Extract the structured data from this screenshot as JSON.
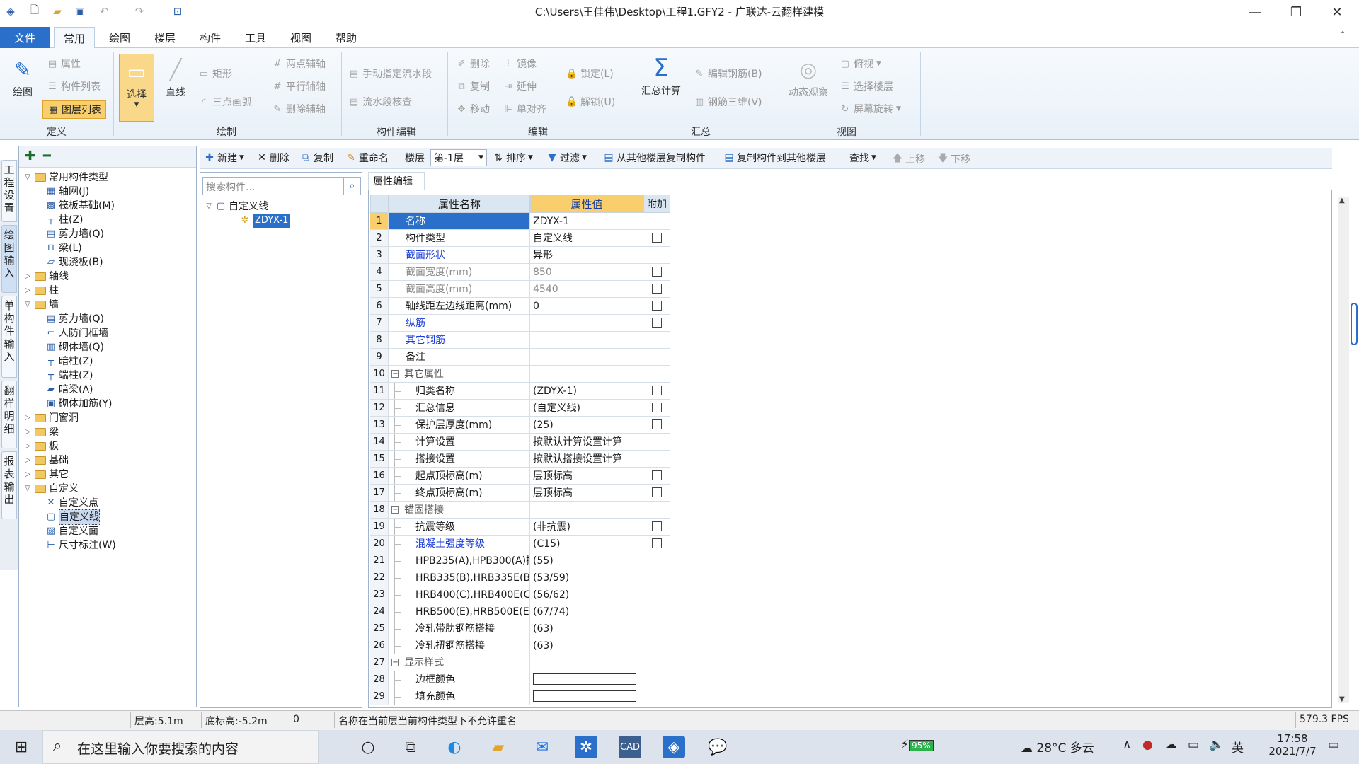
{
  "window": {
    "title": "C:\\Users\\王佳伟\\Desktop\\工程1.GFY2 - 广联达-云翻样建模"
  },
  "menu": {
    "file": "文件",
    "tabs": [
      "常用",
      "绘图",
      "楼层",
      "构件",
      "工具",
      "视图",
      "帮助"
    ]
  },
  "ribbon": {
    "define": {
      "label": "定义",
      "draw_big": "绘图",
      "props": "属性",
      "comp_list": "构件列表",
      "layer_list": "图层列表"
    },
    "draw": {
      "label": "绘制",
      "select": "选择",
      "line": "直线",
      "rect": "矩形",
      "arc3": "三点画弧",
      "two_pt_axis": "两点辅轴",
      "parallel_axis": "平行辅轴",
      "delete_axis": "删除辅轴"
    },
    "comp_edit": {
      "label": "构件编辑",
      "manual_flow": "手动指定流水段",
      "flow_check": "流水段核查"
    },
    "edit": {
      "label": "编辑",
      "delete": "删除",
      "copy": "复制",
      "move": "移动",
      "mirror": "镜像",
      "extend": "延伸",
      "align": "单对齐",
      "lock": "锁定(L)",
      "unlock": "解锁(U)"
    },
    "summary": {
      "label": "汇总",
      "calc": "汇总计算",
      "edit_rebar": "编辑钢筋(B)",
      "rebar3d": "钢筋三维(V)"
    },
    "view": {
      "label": "视图",
      "dynamic": "动态观察",
      "top": "俯视",
      "select_floor": "选择楼层",
      "rotate": "屏幕旋转"
    }
  },
  "toolbar": {
    "new": "新建",
    "delete": "删除",
    "copy": "复制",
    "rename": "重命名",
    "floor_label": "楼层",
    "floor_value": "第-1层",
    "sort": "排序",
    "filter": "过滤",
    "copy_from": "从其他楼层复制构件",
    "copy_to": "复制构件到其他楼层",
    "find": "查找",
    "up": "上移",
    "down": "下移"
  },
  "side_tabs": [
    "工程设置",
    "绘图输入",
    "单构件输入",
    "翻样明细",
    "报表输出"
  ],
  "tree": [
    {
      "label": "常用构件类型",
      "level": 0,
      "type": "folder",
      "open": true
    },
    {
      "label": "轴网(J)",
      "level": 1,
      "type": "leaf",
      "icon": "▦"
    },
    {
      "label": "筏板基础(M)",
      "level": 1,
      "type": "leaf",
      "icon": "▩"
    },
    {
      "label": "柱(Z)",
      "level": 1,
      "type": "leaf",
      "icon": "╥"
    },
    {
      "label": "剪力墙(Q)",
      "level": 1,
      "type": "leaf",
      "icon": "▤"
    },
    {
      "label": "梁(L)",
      "level": 1,
      "type": "leaf",
      "icon": "⊓"
    },
    {
      "label": "现浇板(B)",
      "level": 1,
      "type": "leaf",
      "icon": "▱"
    },
    {
      "label": "轴线",
      "level": 0,
      "type": "folder",
      "open": false
    },
    {
      "label": "柱",
      "level": 0,
      "type": "folder",
      "open": false
    },
    {
      "label": "墙",
      "level": 0,
      "type": "folder",
      "open": true
    },
    {
      "label": "剪力墙(Q)",
      "level": 1,
      "type": "leaf",
      "icon": "▤"
    },
    {
      "label": "人防门框墙",
      "level": 1,
      "type": "leaf",
      "icon": "⌐"
    },
    {
      "label": "砌体墙(Q)",
      "level": 1,
      "type": "leaf",
      "icon": "▥"
    },
    {
      "label": "暗柱(Z)",
      "level": 1,
      "type": "leaf",
      "icon": "╥"
    },
    {
      "label": "端柱(Z)",
      "level": 1,
      "type": "leaf",
      "icon": "╥"
    },
    {
      "label": "暗梁(A)",
      "level": 1,
      "type": "leaf",
      "icon": "▰"
    },
    {
      "label": "砌体加筋(Y)",
      "level": 1,
      "type": "leaf",
      "icon": "▣"
    },
    {
      "label": "门窗洞",
      "level": 0,
      "type": "folder",
      "open": false
    },
    {
      "label": "梁",
      "level": 0,
      "type": "folder",
      "open": false
    },
    {
      "label": "板",
      "level": 0,
      "type": "folder",
      "open": false
    },
    {
      "label": "基础",
      "level": 0,
      "type": "folder",
      "open": false
    },
    {
      "label": "其它",
      "level": 0,
      "type": "folder",
      "open": false
    },
    {
      "label": "自定义",
      "level": 0,
      "type": "folder",
      "open": true
    },
    {
      "label": "自定义点",
      "level": 1,
      "type": "leaf",
      "icon": "✕"
    },
    {
      "label": "自定义线",
      "level": 1,
      "type": "leaf",
      "icon": "▢",
      "selected": true
    },
    {
      "label": "自定义面",
      "level": 1,
      "type": "leaf",
      "icon": "▨"
    },
    {
      "label": "尺寸标注(W)",
      "level": 1,
      "type": "leaf",
      "icon": "⊢"
    }
  ],
  "component_panel": {
    "search_placeholder": "搜索构件...",
    "root": "自定义线",
    "item": "ZDYX-1"
  },
  "property_editor": {
    "tab": "属性编辑",
    "headers": {
      "name": "属性名称",
      "value": "属性值",
      "extra": "附加"
    },
    "rows": [
      {
        "n": "1",
        "name": "名称",
        "value": "ZDYX-1",
        "check": false,
        "style": "sel"
      },
      {
        "n": "2",
        "name": "构件类型",
        "value": "自定义线",
        "check": true,
        "style": ""
      },
      {
        "n": "3",
        "name": "截面形状",
        "value": "异形",
        "check": false,
        "style": "blue"
      },
      {
        "n": "4",
        "name": "截面宽度(mm)",
        "value": "850",
        "check": true,
        "style": "grey"
      },
      {
        "n": "5",
        "name": "截面高度(mm)",
        "value": "4540",
        "check": true,
        "style": "grey"
      },
      {
        "n": "6",
        "name": "轴线距左边线距离(mm)",
        "value": "0",
        "check": true,
        "style": ""
      },
      {
        "n": "7",
        "name": "纵筋",
        "value": "",
        "check": true,
        "style": "blue"
      },
      {
        "n": "8",
        "name": "其它钢筋",
        "value": "",
        "check": false,
        "style": "blue"
      },
      {
        "n": "9",
        "name": "备注",
        "value": "",
        "check": false,
        "style": ""
      },
      {
        "n": "10",
        "name": "其它属性",
        "value": "",
        "check": false,
        "style": "cat"
      },
      {
        "n": "11",
        "name": "归类名称",
        "value": "(ZDYX-1)",
        "check": true,
        "style": "sub"
      },
      {
        "n": "12",
        "name": "汇总信息",
        "value": "(自定义线)",
        "check": true,
        "style": "sub"
      },
      {
        "n": "13",
        "name": "保护层厚度(mm)",
        "value": "(25)",
        "check": true,
        "style": "sub"
      },
      {
        "n": "14",
        "name": "计算设置",
        "value": "按默认计算设置计算",
        "check": false,
        "style": "sub"
      },
      {
        "n": "15",
        "name": "搭接设置",
        "value": "按默认搭接设置计算",
        "check": false,
        "style": "sub"
      },
      {
        "n": "16",
        "name": "起点顶标高(m)",
        "value": "层顶标高",
        "check": true,
        "style": "sub"
      },
      {
        "n": "17",
        "name": "终点顶标高(m)",
        "value": "层顶标高",
        "check": true,
        "style": "sub"
      },
      {
        "n": "18",
        "name": "锚固搭接",
        "value": "",
        "check": false,
        "style": "cat"
      },
      {
        "n": "19",
        "name": "抗震等级",
        "value": "(非抗震)",
        "check": true,
        "style": "sub"
      },
      {
        "n": "20",
        "name": "混凝土强度等级",
        "value": "(C15)",
        "check": true,
        "style": "sub blue"
      },
      {
        "n": "21",
        "name": "HPB235(A),HPB300(A)搭",
        "value": "(55)",
        "check": false,
        "style": "sub"
      },
      {
        "n": "22",
        "name": "HRB335(B),HRB335E(BE),",
        "value": "(53/59)",
        "check": false,
        "style": "sub"
      },
      {
        "n": "23",
        "name": "HRB400(C),HRB400E(CE),",
        "value": "(56/62)",
        "check": false,
        "style": "sub"
      },
      {
        "n": "24",
        "name": "HRB500(E),HRB500E(EE),",
        "value": "(67/74)",
        "check": false,
        "style": "sub"
      },
      {
        "n": "25",
        "name": "冷轧带肋钢筋搭接",
        "value": "(63)",
        "check": false,
        "style": "sub"
      },
      {
        "n": "26",
        "name": "冷轧扭钢筋搭接",
        "value": "(63)",
        "check": false,
        "style": "sub"
      },
      {
        "n": "27",
        "name": "显示样式",
        "value": "",
        "check": false,
        "style": "cat"
      },
      {
        "n": "28",
        "name": "边框颜色",
        "value": "",
        "check": false,
        "style": "sub color"
      },
      {
        "n": "29",
        "name": "填充颜色",
        "value": "",
        "check": false,
        "style": "sub color"
      }
    ]
  },
  "status": {
    "floor_height": "层高:5.1m",
    "bottom_elev": "底标高:-5.2m",
    "count": "0",
    "message": "名称在当前层当前构件类型下不允许重名",
    "fps": "579.3 FPS"
  },
  "taskbar": {
    "search_placeholder": "在这里输入你要搜索的内容",
    "battery": "95%",
    "weather": "28°C 多云",
    "ime": "英",
    "time": "17:58",
    "date": "2021/7/7"
  },
  "colors": {
    "accent": "#2a6fc9",
    "value_header": "#f9cf6d",
    "link_blue": "#1b3ed8"
  }
}
